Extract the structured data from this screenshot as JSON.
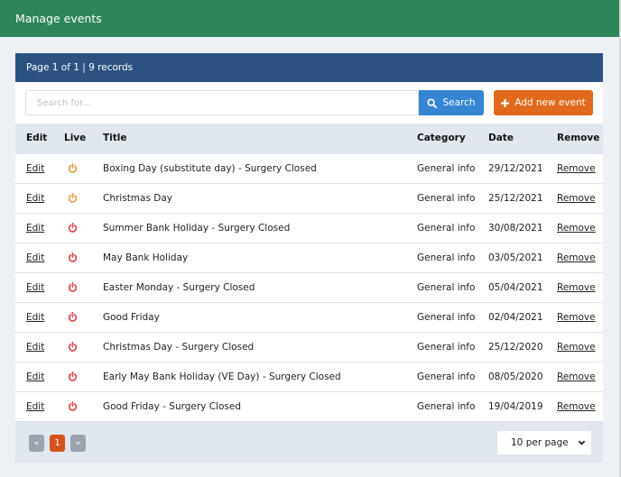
{
  "header": {
    "title": "Manage events"
  },
  "panel": {
    "summary": "Page 1 of 1 | 9 records"
  },
  "toolbar": {
    "search_placeholder": "Search for...",
    "search_value": "",
    "search_label": "Search",
    "add_label": "Add new event"
  },
  "colors": {
    "live_on": "#e8a04a",
    "live_off": "#e0484b",
    "header_green": "#2e855a",
    "panel_blue": "#2c5282",
    "search_blue": "#3585d3",
    "add_orange": "#e0691c"
  },
  "table": {
    "columns": [
      "Edit",
      "Live",
      "Title",
      "Category",
      "Date",
      "Remove"
    ],
    "rows": [
      {
        "edit": "Edit",
        "live": true,
        "title": "Boxing Day (substitute day) - Surgery Closed",
        "category": "General info",
        "date": "29/12/2021",
        "remove": "Remove"
      },
      {
        "edit": "Edit",
        "live": true,
        "title": "Christmas Day",
        "category": "General info",
        "date": "25/12/2021",
        "remove": "Remove"
      },
      {
        "edit": "Edit",
        "live": false,
        "title": "Summer Bank Holiday - Surgery Closed",
        "category": "General info",
        "date": "30/08/2021",
        "remove": "Remove"
      },
      {
        "edit": "Edit",
        "live": false,
        "title": "May Bank Holiday",
        "category": "General info",
        "date": "03/05/2021",
        "remove": "Remove"
      },
      {
        "edit": "Edit",
        "live": false,
        "title": "Easter Monday - Surgery Closed",
        "category": "General info",
        "date": "05/04/2021",
        "remove": "Remove"
      },
      {
        "edit": "Edit",
        "live": false,
        "title": "Good Friday",
        "category": "General info",
        "date": "02/04/2021",
        "remove": "Remove"
      },
      {
        "edit": "Edit",
        "live": false,
        "title": "Christmas Day - Surgery Closed",
        "category": "General info",
        "date": "25/12/2020",
        "remove": "Remove"
      },
      {
        "edit": "Edit",
        "live": false,
        "title": "Early May Bank Holiday (VE Day) - Surgery Closed",
        "category": "General info",
        "date": "08/05/2020",
        "remove": "Remove"
      },
      {
        "edit": "Edit",
        "live": false,
        "title": "Good Friday - Surgery Closed",
        "category": "General info",
        "date": "19/04/2019",
        "remove": "Remove"
      }
    ]
  },
  "pagination": {
    "prev_label": "«",
    "current_page": "1",
    "next_label": "»",
    "per_page_selected": "10 per page"
  }
}
